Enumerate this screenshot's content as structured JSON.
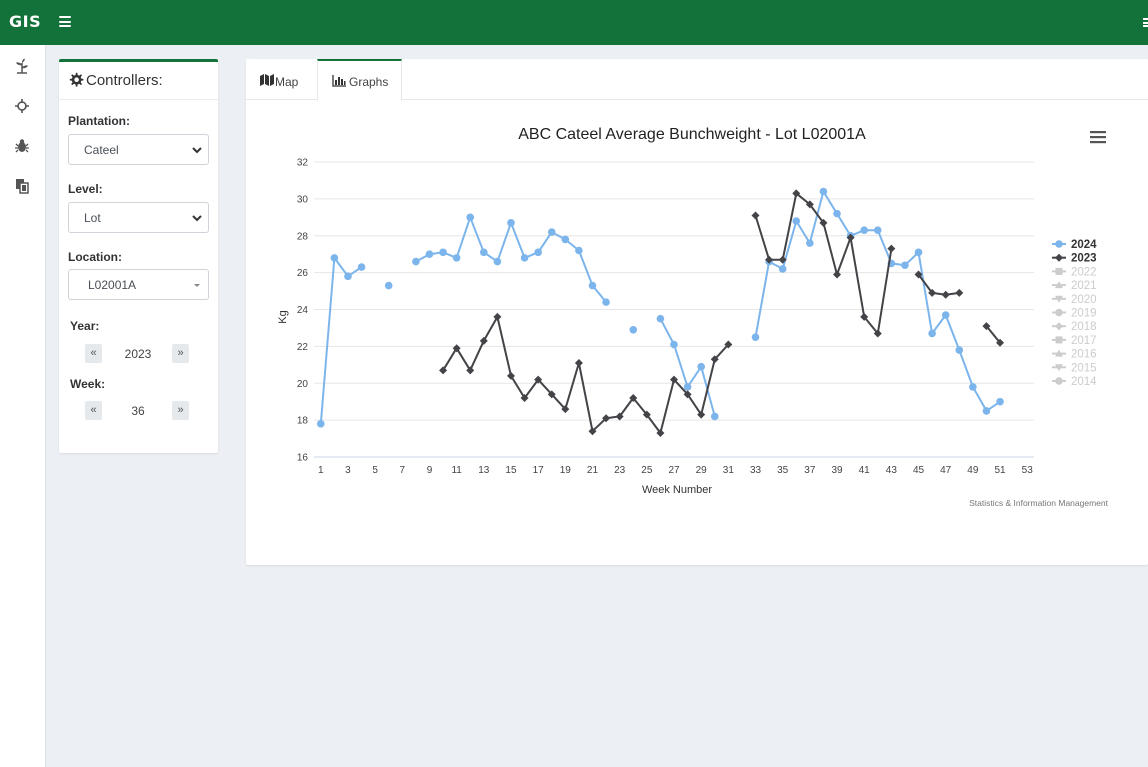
{
  "app": {
    "brand": "GIS"
  },
  "nav": {
    "icons": [
      "plant-icon",
      "crosshair-icon",
      "bug-icon",
      "copy-icon"
    ]
  },
  "controllers": {
    "title": "Controllers:",
    "plantation": {
      "label": "Plantation:",
      "value": "Cateel"
    },
    "level": {
      "label": "Level:",
      "value": "Lot"
    },
    "location": {
      "label": "Location:",
      "value": "L02001A"
    },
    "year": {
      "label": "Year:",
      "value": "2023",
      "prev": "«",
      "next": "»"
    },
    "week": {
      "label": "Week:",
      "value": "36",
      "prev": "«",
      "next": "»"
    }
  },
  "tabs": [
    {
      "label": "Map",
      "active": false
    },
    {
      "label": "Graphs",
      "active": true
    }
  ],
  "chart_data": {
    "type": "line",
    "title": "ABC Cateel Average Bunchweight - Lot L02001A",
    "xlabel": "Week Number",
    "ylabel": "Kg",
    "credit": "Statistics & Information Management",
    "xlim": [
      0.5,
      53.5
    ],
    "ylim": [
      16,
      32
    ],
    "xticks": [
      1,
      3,
      5,
      7,
      9,
      11,
      13,
      15,
      17,
      19,
      21,
      23,
      25,
      27,
      29,
      31,
      33,
      35,
      37,
      39,
      41,
      43,
      45,
      47,
      49,
      51,
      53
    ],
    "yticks": [
      16,
      18,
      20,
      22,
      24,
      26,
      28,
      30,
      32
    ],
    "grid": "horizontal",
    "legend_position": "right",
    "series": [
      {
        "name": "2024",
        "color": "#7cb5ec",
        "marker": "circle",
        "visible": true,
        "points": [
          [
            1,
            17.8
          ],
          [
            2,
            26.8
          ],
          [
            3,
            25.8
          ],
          [
            4,
            26.3
          ],
          [
            6,
            25.3
          ],
          [
            8,
            26.6
          ],
          [
            9,
            27.0
          ],
          [
            10,
            27.1
          ],
          [
            11,
            26.8
          ],
          [
            12,
            29.0
          ],
          [
            13,
            27.1
          ],
          [
            14,
            26.6
          ],
          [
            15,
            28.7
          ],
          [
            16,
            26.8
          ],
          [
            17,
            27.1
          ],
          [
            18,
            28.2
          ],
          [
            19,
            27.8
          ],
          [
            20,
            27.2
          ],
          [
            21,
            25.3
          ],
          [
            22,
            24.4
          ],
          [
            24,
            22.9
          ],
          [
            26,
            23.5
          ],
          [
            27,
            22.1
          ],
          [
            28,
            19.8
          ],
          [
            29,
            20.9
          ],
          [
            30,
            18.2
          ],
          [
            33,
            22.5
          ],
          [
            34,
            26.6
          ],
          [
            35,
            26.2
          ],
          [
            36,
            28.8
          ],
          [
            37,
            27.6
          ],
          [
            38,
            30.4
          ],
          [
            39,
            29.2
          ],
          [
            40,
            28.0
          ],
          [
            41,
            28.3
          ],
          [
            42,
            28.3
          ],
          [
            43,
            26.5
          ],
          [
            44,
            26.4
          ],
          [
            45,
            27.1
          ],
          [
            46,
            22.7
          ],
          [
            47,
            23.7
          ],
          [
            48,
            21.8
          ],
          [
            49,
            19.8
          ],
          [
            50,
            18.5
          ],
          [
            51,
            19.0
          ]
        ],
        "breaks_after": [
          4,
          6,
          22,
          24,
          30
        ]
      },
      {
        "name": "2023",
        "color": "#434348",
        "marker": "diamond",
        "visible": true,
        "points": [
          [
            10,
            20.7
          ],
          [
            11,
            21.9
          ],
          [
            12,
            20.7
          ],
          [
            13,
            22.3
          ],
          [
            14,
            23.6
          ],
          [
            15,
            20.4
          ],
          [
            16,
            19.2
          ],
          [
            17,
            20.2
          ],
          [
            18,
            19.4
          ],
          [
            19,
            18.6
          ],
          [
            20,
            21.1
          ],
          [
            21,
            17.4
          ],
          [
            22,
            18.1
          ],
          [
            23,
            18.2
          ],
          [
            24,
            19.2
          ],
          [
            25,
            18.3
          ],
          [
            26,
            17.3
          ],
          [
            27,
            20.2
          ],
          [
            28,
            19.4
          ],
          [
            29,
            18.3
          ],
          [
            30,
            21.3
          ],
          [
            31,
            22.1
          ],
          [
            33,
            29.1
          ],
          [
            34,
            26.7
          ],
          [
            35,
            26.7
          ],
          [
            36,
            30.3
          ],
          [
            37,
            29.7
          ],
          [
            38,
            28.7
          ],
          [
            39,
            25.9
          ],
          [
            40,
            27.9
          ],
          [
            41,
            23.6
          ],
          [
            42,
            22.7
          ],
          [
            43,
            27.3
          ],
          [
            45,
            25.9
          ],
          [
            46,
            24.9
          ],
          [
            47,
            24.8
          ],
          [
            48,
            24.9
          ],
          [
            50,
            23.1
          ],
          [
            51,
            22.2
          ]
        ],
        "breaks_after": [
          31,
          43,
          48
        ]
      },
      {
        "name": "2022",
        "color": "#cccccc",
        "marker": "square",
        "visible": false
      },
      {
        "name": "2021",
        "color": "#cccccc",
        "marker": "triangle",
        "visible": false
      },
      {
        "name": "2020",
        "color": "#cccccc",
        "marker": "triangle-down",
        "visible": false
      },
      {
        "name": "2019",
        "color": "#cccccc",
        "marker": "circle",
        "visible": false
      },
      {
        "name": "2018",
        "color": "#cccccc",
        "marker": "diamond",
        "visible": false
      },
      {
        "name": "2017",
        "color": "#cccccc",
        "marker": "square",
        "visible": false
      },
      {
        "name": "2016",
        "color": "#cccccc",
        "marker": "triangle",
        "visible": false
      },
      {
        "name": "2015",
        "color": "#cccccc",
        "marker": "triangle-down",
        "visible": false
      },
      {
        "name": "2014",
        "color": "#cccccc",
        "marker": "circle",
        "visible": false
      }
    ]
  }
}
